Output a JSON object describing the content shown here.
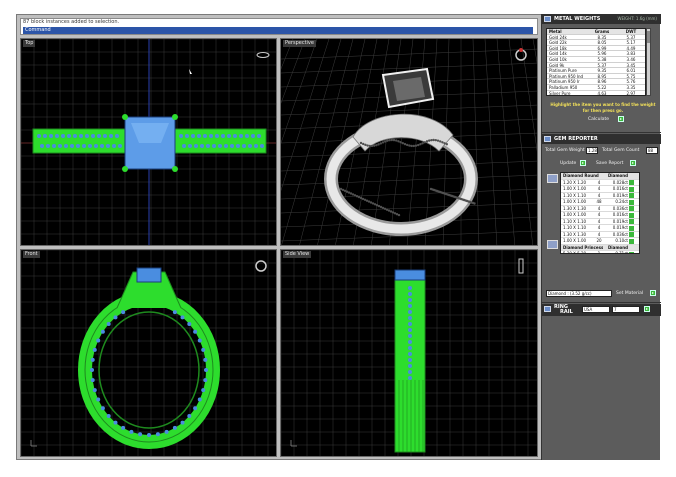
{
  "command": {
    "history_line": "87 block instances added to selection.",
    "prompt": "Command"
  },
  "viewports": [
    {
      "label": "Top"
    },
    {
      "label": "Perspective"
    },
    {
      "label": "Front"
    },
    {
      "label": "Side View"
    }
  ],
  "metal_weights": {
    "title": "METAL WEIGHTS",
    "subtitle": "WEIGHT: 1.6g (mm)",
    "columns": [
      "Metal",
      "Grams",
      "DWT"
    ],
    "rows": [
      [
        "Gold 24k",
        "8.35",
        "5.37"
      ],
      [
        "Gold 22k",
        "8.05",
        "5.17"
      ],
      [
        "Gold 18k",
        "6.99",
        "4.49"
      ],
      [
        "Gold 14k",
        "5.96",
        "3.83"
      ],
      [
        "Gold 10k",
        "5.38",
        "3.46"
      ],
      [
        "Gold 9k",
        "5.37",
        "3.45"
      ],
      [
        "Platinum Pure",
        "9.35",
        "6.01"
      ],
      [
        "Platinum 950 Ind",
        "8.95",
        "5.75"
      ],
      [
        "Platinum 950 Ir",
        "8.96",
        "5.76"
      ],
      [
        "Palladium 950",
        "5.22",
        "3.35"
      ],
      [
        "Silver Pure",
        "4.63",
        "2.97"
      ],
      [
        "Silver Sterling",
        "4.56",
        "2.93"
      ]
    ],
    "hint": "Highlight the item you want to find the weight for then press go.",
    "calculate_label": "Calculate"
  },
  "gem_reporter": {
    "title": "GEM REPORTER",
    "total_weight_label": "Total Gem Weight",
    "total_weight_value": "1.28",
    "total_count_label": "Total Gem Count",
    "total_count_value": "88",
    "update_label": "Update",
    "save_label": "Save Report",
    "groups": [
      {
        "header": [
          "Diamond Round",
          "Diamond"
        ],
        "rows": [
          [
            "1.20 X 1.20",
            "4",
            "0.028ct"
          ],
          [
            "1.00 X 1.00",
            "4",
            "0.016ct"
          ],
          [
            "1.10 X 1.10",
            "4",
            "0.019ct"
          ],
          [
            "1.00 X 1.00",
            "48",
            "0.24ct"
          ],
          [
            "1.30 X 1.30",
            "4",
            "0.036ct"
          ],
          [
            "1.00 X 1.00",
            "4",
            "0.016ct"
          ],
          [
            "1.10 X 1.10",
            "4",
            "0.019ct"
          ],
          [
            "1.10 X 1.10",
            "4",
            "0.019ct"
          ],
          [
            "1.30 X 1.30",
            "4",
            "0.036ct"
          ],
          [
            "1.00 X 1.00",
            "20",
            "0.10ct"
          ]
        ]
      },
      {
        "header": [
          "Diamond Princess",
          "Diamond"
        ],
        "rows": [
          [
            "5.20 X 5.20",
            "1",
            "0.71ct"
          ]
        ]
      }
    ],
    "material_value": "Diamond : (3.52 g/cc)",
    "set_material_label": "Set Material"
  },
  "ring_size": {
    "title": "RING",
    "subtitle": "RAIL",
    "system_value": "USA",
    "size_value": "7"
  }
}
